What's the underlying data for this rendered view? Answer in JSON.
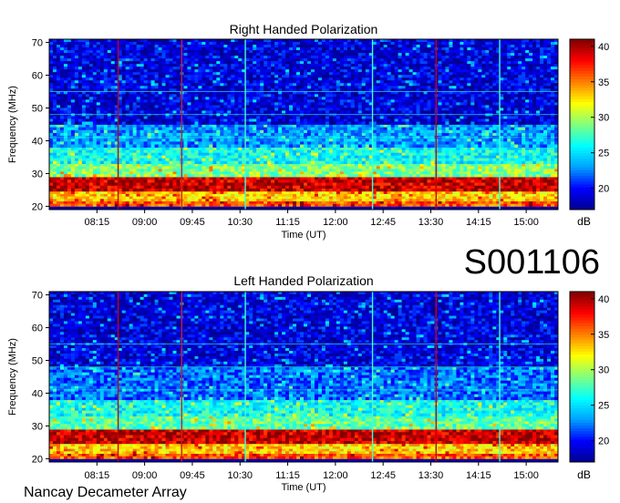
{
  "id_label": "S001106",
  "footer": "Nancay Decameter Array",
  "colorbar": {
    "unit": "dB",
    "range": [
      17,
      41
    ],
    "ticks": [
      20,
      25,
      30,
      35,
      40
    ],
    "stops": [
      "#00008f",
      "#0000ff",
      "#00a0ff",
      "#00ffff",
      "#80ff80",
      "#ffff00",
      "#ff8000",
      "#ff0000",
      "#800000"
    ]
  },
  "chart_data": [
    {
      "type": "heatmap",
      "title": "Right Handed Polarization",
      "xlabel": "Time (UT)",
      "ylabel": "Frequency (MHz)",
      "x_ticks": [
        "08:15",
        "09:00",
        "09:45",
        "10:30",
        "11:15",
        "12:00",
        "12:45",
        "13:30",
        "14:15",
        "15:00"
      ],
      "x_tick_minutes": [
        495,
        540,
        585,
        630,
        675,
        720,
        765,
        810,
        855,
        900
      ],
      "xlim_minutes": [
        450,
        930
      ],
      "y_ticks": [
        20,
        30,
        40,
        50,
        60,
        70
      ],
      "ylim": [
        19,
        71
      ],
      "vertical_lines": [
        {
          "time": "08:35",
          "color": "#cc0000"
        },
        {
          "time": "09:35",
          "color": "#cc2020"
        },
        {
          "time": "10:35",
          "color": "#40ffd0"
        },
        {
          "time": "12:35",
          "color": "#40ffd0"
        },
        {
          "time": "13:35",
          "color": "#cc0000"
        },
        {
          "time": "14:35",
          "color": "#40ffd0"
        }
      ],
      "bands": [
        {
          "f_from": 24.5,
          "f_to": 29,
          "level": 39
        },
        {
          "f_from": 21.5,
          "f_to": 24.5,
          "level": 33
        },
        {
          "f_from": 20,
          "f_to": 21.5,
          "level": 36
        },
        {
          "f_from": 29,
          "f_to": 33,
          "level": 29
        },
        {
          "f_from": 33,
          "f_to": 38,
          "level": 26
        },
        {
          "f_from": 38,
          "f_to": 45,
          "level": 23
        },
        {
          "f_from": 45,
          "f_to": 71,
          "level": 19
        }
      ]
    },
    {
      "type": "heatmap",
      "title": "Left Handed Polarization",
      "xlabel": "Time (UT)",
      "ylabel": "Frequency (MHz)",
      "x_ticks": [
        "08:15",
        "09:00",
        "09:45",
        "10:30",
        "11:15",
        "12:00",
        "12:45",
        "13:30",
        "14:15",
        "15:00"
      ],
      "x_tick_minutes": [
        495,
        540,
        585,
        630,
        675,
        720,
        765,
        810,
        855,
        900
      ],
      "xlim_minutes": [
        450,
        930
      ],
      "y_ticks": [
        20,
        30,
        40,
        50,
        60,
        70
      ],
      "ylim": [
        19,
        71
      ],
      "vertical_lines": [
        {
          "time": "08:35",
          "color": "#cc0000"
        },
        {
          "time": "09:35",
          "color": "#cc2020"
        },
        {
          "time": "10:35",
          "color": "#40ffd0"
        },
        {
          "time": "12:35",
          "color": "#40ffd0"
        },
        {
          "time": "13:35",
          "color": "#cc0000"
        },
        {
          "time": "14:35",
          "color": "#40ffd0"
        }
      ],
      "bands": [
        {
          "f_from": 24.5,
          "f_to": 29,
          "level": 39
        },
        {
          "f_from": 21.5,
          "f_to": 24.5,
          "level": 33
        },
        {
          "f_from": 20,
          "f_to": 21.5,
          "level": 36
        },
        {
          "f_from": 29,
          "f_to": 33,
          "level": 28
        },
        {
          "f_from": 33,
          "f_to": 38,
          "level": 26
        },
        {
          "f_from": 38,
          "f_to": 48,
          "level": 22
        },
        {
          "f_from": 48,
          "f_to": 71,
          "level": 19
        }
      ]
    }
  ]
}
